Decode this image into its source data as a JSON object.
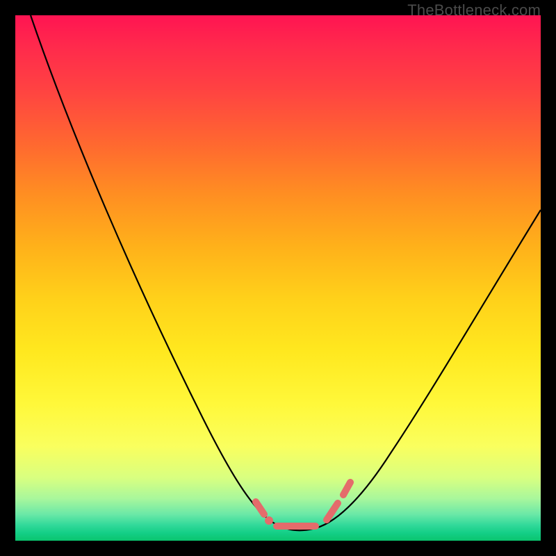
{
  "watermark": "TheBottleneck.com",
  "chart_data": {
    "type": "line",
    "title": "",
    "xlabel": "",
    "ylabel": "",
    "xlim": [
      0,
      100
    ],
    "ylim": [
      0,
      100
    ],
    "grid": false,
    "series": [
      {
        "name": "bottleneck-curve",
        "x": [
          3,
          10,
          18,
          26,
          34,
          40,
          45,
          48,
          50,
          52,
          54,
          56,
          58,
          60,
          63,
          67,
          72,
          78,
          85,
          92,
          100
        ],
        "y": [
          100,
          80,
          62,
          45,
          30,
          18,
          10,
          5,
          2,
          1,
          1,
          1,
          2,
          4,
          8,
          15,
          24,
          35,
          47,
          58,
          68
        ]
      }
    ],
    "highlight_region": {
      "name": "optimal-zone",
      "x_range": [
        48,
        60
      ],
      "y_value": 1
    },
    "background_gradient": {
      "top_color": "#ff1452",
      "bottom_color": "#0ac46e",
      "meaning": "red = high bottleneck, green = low bottleneck"
    }
  }
}
